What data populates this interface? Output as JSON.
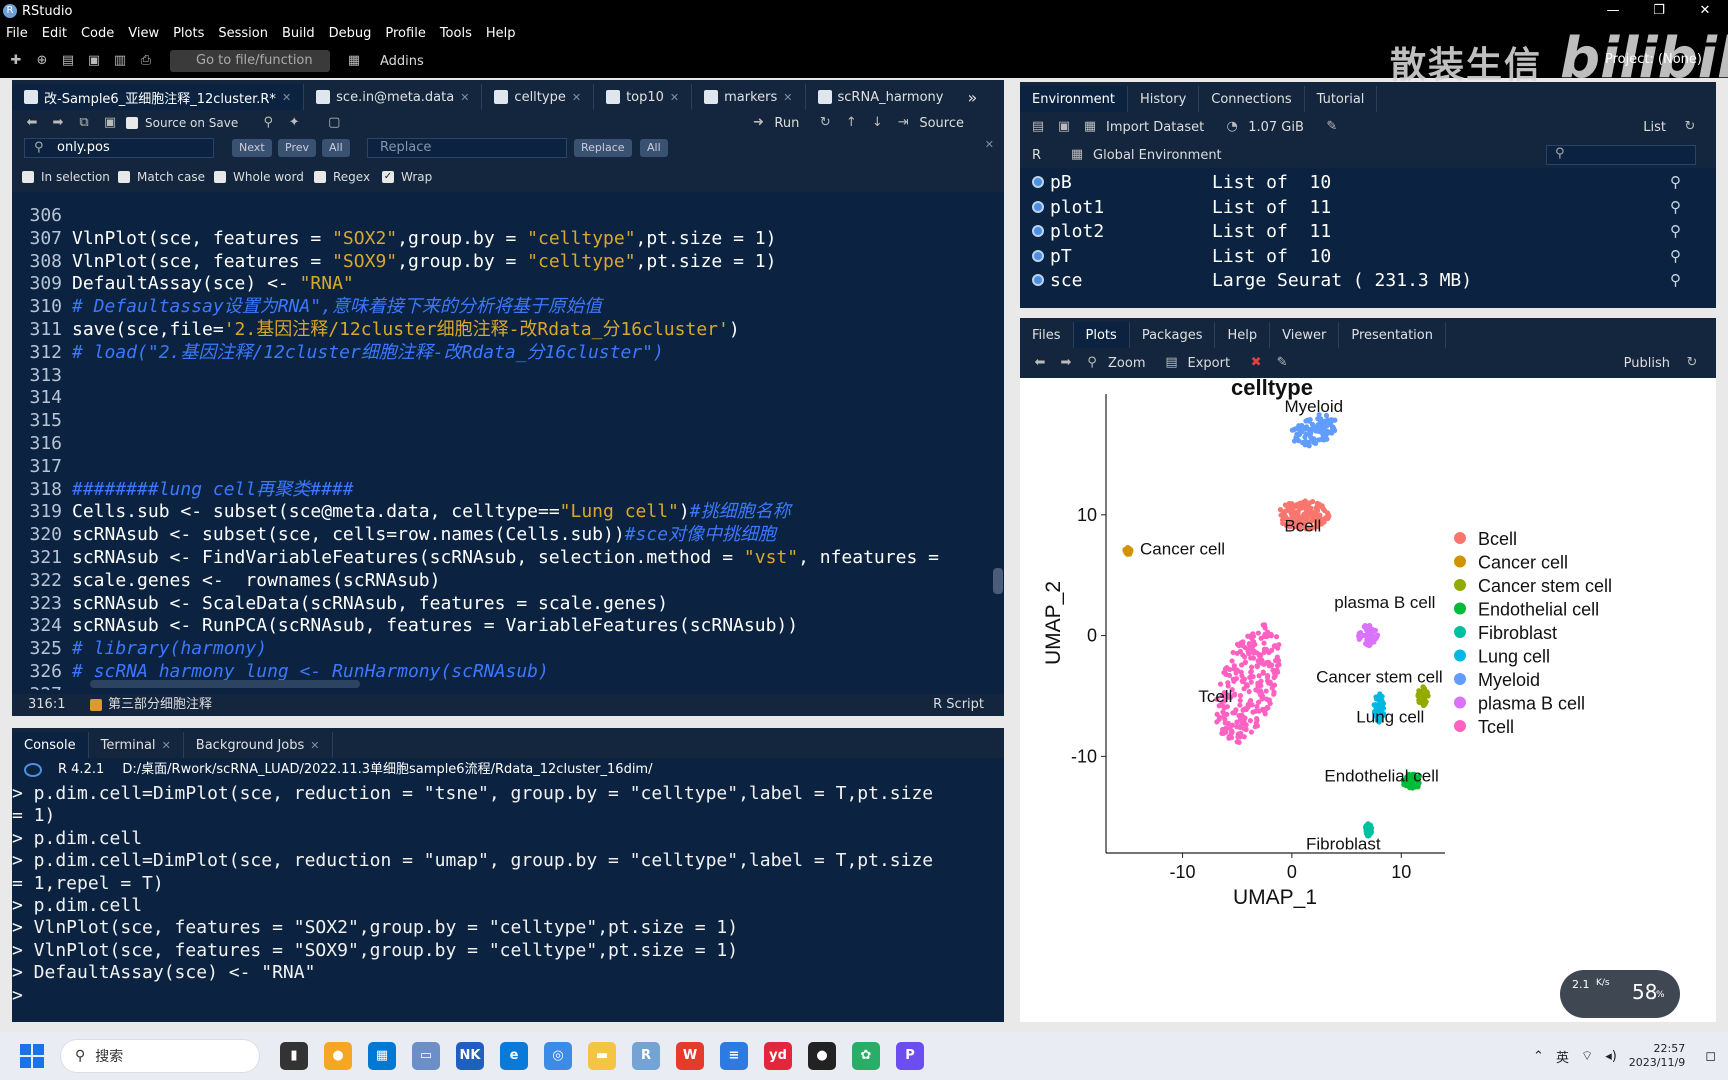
{
  "app": {
    "title": "RStudio",
    "window_controls": [
      "—",
      "❐",
      "✕"
    ]
  },
  "menu": [
    "File",
    "Edit",
    "Code",
    "View",
    "Plots",
    "Session",
    "Build",
    "Debug",
    "Profile",
    "Tools",
    "Help"
  ],
  "toolbar": {
    "goto_placeholder": "Go to file/function",
    "addins": "Addins",
    "project": "Project: (None)"
  },
  "watermark": {
    "text": "散装生信",
    "logo": "bilibili"
  },
  "editor": {
    "tabs": [
      {
        "label": "改-Sample6_亚细胞注释_12cluster.R*",
        "active": true
      },
      {
        "label": "sce.in@meta.data"
      },
      {
        "label": "celltype"
      },
      {
        "label": "top10"
      },
      {
        "label": "markers"
      },
      {
        "label": "scRNA_harmony"
      }
    ],
    "overflow": "»",
    "toolbar": {
      "source_on_save": "Source on Save",
      "run": "Run",
      "source": "Source"
    },
    "find": {
      "value": "only.pos",
      "next": "Next",
      "prev": "Prev",
      "all": "All",
      "replace_placeholder": "Replace",
      "replace": "Replace",
      "replace_all": "All"
    },
    "options": [
      {
        "label": "In selection",
        "checked": false
      },
      {
        "label": "Match case",
        "checked": false
      },
      {
        "label": "Whole word",
        "checked": false
      },
      {
        "label": "Regex",
        "checked": false
      },
      {
        "label": "Wrap",
        "checked": true
      }
    ],
    "lines": [
      {
        "n": "306",
        "parts": []
      },
      {
        "n": "307",
        "parts": [
          [
            "t",
            "VlnPlot(sce, features = "
          ],
          [
            "s",
            "\"SOX2\""
          ],
          [
            "t",
            ",group.by = "
          ],
          [
            "s",
            "\"celltype\""
          ],
          [
            "t",
            ",pt.size = 1)"
          ]
        ]
      },
      {
        "n": "308",
        "parts": [
          [
            "t",
            "VlnPlot(sce, features = "
          ],
          [
            "s",
            "\"SOX9\""
          ],
          [
            "t",
            ",group.by = "
          ],
          [
            "s",
            "\"celltype\""
          ],
          [
            "t",
            ",pt.size = 1)"
          ]
        ]
      },
      {
        "n": "309",
        "parts": [
          [
            "t",
            "DefaultAssay(sce) <- "
          ],
          [
            "s",
            "\"RNA\""
          ]
        ]
      },
      {
        "n": "310",
        "parts": [
          [
            "c",
            "# Defaultassay设置为RNA\",意味着接下来的分析将基于原始值"
          ]
        ]
      },
      {
        "n": "311",
        "parts": [
          [
            "t",
            "save(sce,file="
          ],
          [
            "s",
            "'2.基因注释/12cluster细胞注释-改Rdata_分16cluster'"
          ],
          [
            "t",
            ")"
          ]
        ]
      },
      {
        "n": "312",
        "parts": [
          [
            "c",
            "# load(\"2.基因注释/12cluster细胞注释-改Rdata_分16cluster\")"
          ]
        ]
      },
      {
        "n": "313",
        "parts": []
      },
      {
        "n": "314",
        "parts": []
      },
      {
        "n": "315",
        "parts": []
      },
      {
        "n": "316",
        "parts": []
      },
      {
        "n": "317",
        "parts": []
      },
      {
        "n": "318",
        "parts": [
          [
            "c",
            "########lung cell再聚类####"
          ]
        ]
      },
      {
        "n": "319",
        "parts": [
          [
            "t",
            "Cells.sub <- subset(sce@meta.data, celltype=="
          ],
          [
            "s",
            "\"Lung cell\""
          ],
          [
            "t",
            ")"
          ],
          [
            "c",
            "#挑细胞名称"
          ]
        ]
      },
      {
        "n": "320",
        "parts": [
          [
            "t",
            "scRNAsub <- subset(sce, cells=row.names(Cells.sub))"
          ],
          [
            "c",
            "#sce对像中挑细胞"
          ]
        ]
      },
      {
        "n": "321",
        "parts": [
          [
            "t",
            "scRNAsub <- FindVariableFeatures(scRNAsub, selection.method = "
          ],
          [
            "s",
            "\"vst\""
          ],
          [
            "t",
            ", nfeatures ="
          ]
        ]
      },
      {
        "n": "322",
        "parts": [
          [
            "t",
            "scale.genes <-  rownames(scRNAsub)"
          ]
        ]
      },
      {
        "n": "323",
        "parts": [
          [
            "t",
            "scRNAsub <- ScaleData(scRNAsub, features = scale.genes)"
          ]
        ]
      },
      {
        "n": "324",
        "parts": [
          [
            "t",
            "scRNAsub <- RunPCA(scRNAsub, features = VariableFeatures(scRNAsub))"
          ]
        ]
      },
      {
        "n": "325",
        "parts": [
          [
            "c",
            "# library(harmony)"
          ]
        ]
      },
      {
        "n": "326",
        "parts": [
          [
            "c",
            "# scRNA_harmony_lung <- RunHarmony(scRNAsub)"
          ]
        ]
      },
      {
        "n": "327",
        "parts": []
      }
    ],
    "status": {
      "position": "316:1",
      "section": "第三部分细胞注释",
      "type": "R Script"
    }
  },
  "console": {
    "tabs": [
      {
        "label": "Console",
        "active": true
      },
      {
        "label": "Terminal"
      },
      {
        "label": "Background Jobs"
      }
    ],
    "r_version": "R 4.2.1",
    "path": "D:/桌面/Rwork/scRNA_LUAD/2022.11.3单细胞sample6流程/Rdata_12cluster_16dim/",
    "lines": [
      "> p.dim.cell=DimPlot(sce, reduction = \"tsne\", group.by = \"celltype\",label = T,pt.size",
      "= 1)",
      "> p.dim.cell",
      "> p.dim.cell=DimPlot(sce, reduction = \"umap\", group.by = \"celltype\",label = T,pt.size",
      "= 1,repel = T)",
      "> p.dim.cell",
      "> VlnPlot(sce, features = \"SOX2\",group.by = \"celltype\",pt.size = 1)",
      "> VlnPlot(sce, features = \"SOX9\",group.by = \"celltype\",pt.size = 1)",
      "> DefaultAssay(sce) <- \"RNA\"",
      ">"
    ]
  },
  "environment": {
    "tabs": [
      {
        "label": "Environment",
        "active": true
      },
      {
        "label": "History"
      },
      {
        "label": "Connections"
      },
      {
        "label": "Tutorial"
      }
    ],
    "import_dataset": "Import Dataset",
    "memory": "1.07 GiB",
    "list_view": "List",
    "lang": "R",
    "scope": "Global Environment",
    "vars": [
      {
        "name": "pB",
        "value": "List of  10"
      },
      {
        "name": "plot1",
        "value": "List of  11"
      },
      {
        "name": "plot2",
        "value": "List of  11"
      },
      {
        "name": "pT",
        "value": "List of  10"
      },
      {
        "name": "sce",
        "value": "Large Seurat ( 231.3 MB)"
      }
    ]
  },
  "files": {
    "tabs": [
      {
        "label": "Files"
      },
      {
        "label": "Plots",
        "active": true
      },
      {
        "label": "Packages"
      },
      {
        "label": "Help"
      },
      {
        "label": "Viewer"
      },
      {
        "label": "Presentation"
      }
    ],
    "zoom": "Zoom",
    "export": "Export",
    "publish": "Publish"
  },
  "chart_data": {
    "type": "scatter",
    "title": "celltype",
    "xlabel": "UMAP_1",
    "ylabel": "UMAP_2",
    "xticks": [
      "-10",
      "0",
      "10"
    ],
    "yticks": [
      "10",
      "0",
      "-10"
    ],
    "xlim": [
      -17,
      14
    ],
    "ylim": [
      -18,
      20
    ],
    "legend_position": "right",
    "series": [
      {
        "name": "Bcell",
        "color": "#f8766d",
        "x": 1,
        "y": 10,
        "label": "Bcell"
      },
      {
        "name": "Cancer cell",
        "color": "#d39200",
        "x": -15,
        "y": 7,
        "label": "Cancer cell"
      },
      {
        "name": "Cancer stem cell",
        "color": "#93aa00",
        "x": 12,
        "y": -5,
        "label": "Cancer stem cell"
      },
      {
        "name": "Endothelial cell",
        "color": "#00ba38",
        "x": 11,
        "y": -12,
        "label": "Endothelial cell"
      },
      {
        "name": "Fibroblast",
        "color": "#00c19f",
        "x": 7,
        "y": -16,
        "label": "Fibroblast"
      },
      {
        "name": "Lung cell",
        "color": "#00b9e3",
        "x": 8,
        "y": -6,
        "label": "Lung cell"
      },
      {
        "name": "Myeloid",
        "color": "#619cff",
        "x": 2,
        "y": 17,
        "label": "Myeloid"
      },
      {
        "name": "plasma B cell",
        "color": "#db72fb",
        "x": 7,
        "y": 0,
        "label": "plasma B cell"
      },
      {
        "name": "Tcell",
        "color": "#ff61c3",
        "x": -4,
        "y": -4,
        "label": "Tcell"
      }
    ]
  },
  "taskbar": {
    "search": "搜索",
    "time": "22:57",
    "date": "2023/11/9",
    "ime": "英",
    "net_up": "2.1",
    "net_unit": "K/s",
    "cpu": "58",
    "cpu_unit": "%"
  }
}
